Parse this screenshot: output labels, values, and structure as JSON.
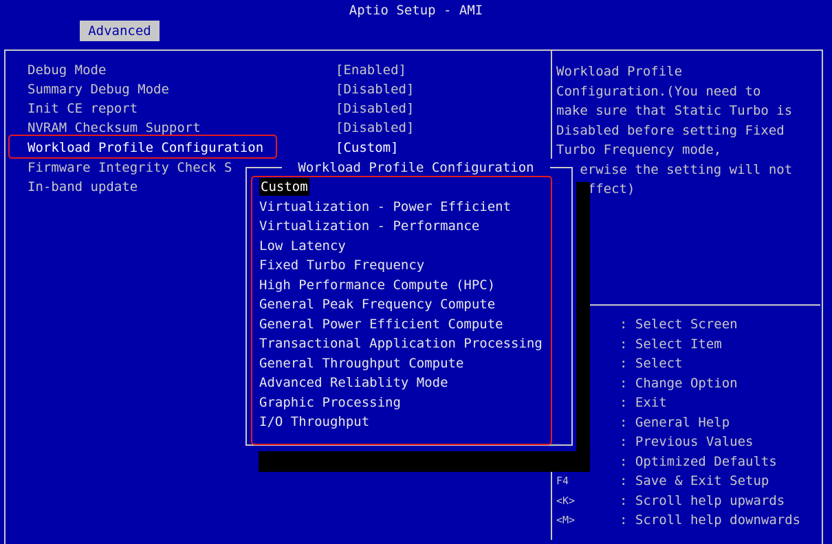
{
  "app": {
    "title": "Aptio Setup - AMI"
  },
  "tabs": [
    {
      "label": "Advanced"
    }
  ],
  "menu": {
    "items": [
      {
        "label": "Debug Mode",
        "value": "[Enabled]"
      },
      {
        "label": "Summary Debug Mode",
        "value": "[Disabled]"
      },
      {
        "label": "Init CE report",
        "value": "[Disabled]"
      },
      {
        "label": "NVRAM Checksum Support",
        "value": "[Disabled]"
      },
      {
        "label": "Workload Profile Configuration",
        "value": "[Custom]"
      },
      {
        "label": "Firmware Integrity Check S",
        "value": ""
      },
      {
        "label": "In-band update",
        "value": ""
      }
    ]
  },
  "help": {
    "text": "Workload Profile\nConfiguration.(You need to\nmake sure that Static Turbo is\nDisabled before setting Fixed\nTurbo Frequency mode,\n   erwise the setting will not\n   effect)"
  },
  "keys": [
    {
      "key": "",
      "desc": ": Select Screen"
    },
    {
      "key": "",
      "desc": ": Select Item"
    },
    {
      "key": "",
      "desc": ": Select"
    },
    {
      "key": "",
      "desc": ": Change Option"
    },
    {
      "key": "",
      "desc": ": Exit"
    },
    {
      "key": "",
      "desc": ": General Help"
    },
    {
      "key": "",
      "desc": ": Previous Values"
    },
    {
      "key": "",
      "desc": ": Optimized Defaults"
    },
    {
      "key": "F4",
      "desc": ": Save & Exit Setup"
    },
    {
      "key": "<K>",
      "desc": ": Scroll help upwards"
    },
    {
      "key": "<M>",
      "desc": ": Scroll help downwards"
    }
  ],
  "popup": {
    "title": " Workload Profile Configuration ",
    "options": [
      "Custom",
      "Virtualization - Power Efficient",
      "Virtualization - Performance",
      "Low Latency",
      "Fixed Turbo Frequency",
      "High Performance Compute (HPC)",
      "General Peak Frequency Compute",
      "General Power Efficient Compute",
      "Transactional Application Processing",
      "General Throughput Compute",
      "Advanced Reliablity Mode",
      "Graphic Processing",
      "I/O Throughput"
    ],
    "selected_index": 0
  },
  "colors": {
    "background": "#0000a8",
    "text": "#c8c8c8",
    "highlight_box": "#e21c1c",
    "tab_background": "#c8c8c8"
  }
}
